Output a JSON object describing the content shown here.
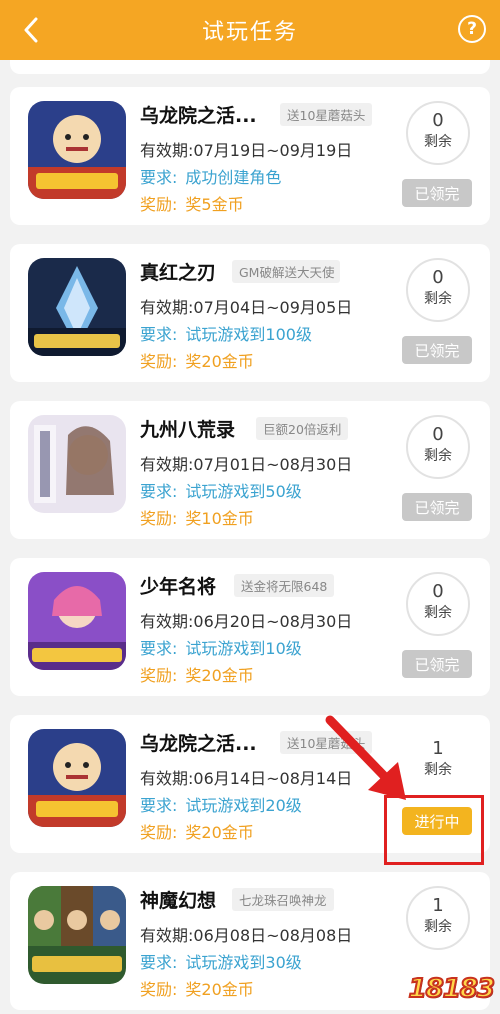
{
  "header": {
    "title": "试玩任务",
    "help_symbol": "?"
  },
  "labels": {
    "valid_prefix": "有效期:",
    "requirement": "要求:",
    "reward": "奖励:",
    "remain": "剩余"
  },
  "tasks": [
    {
      "name": "乌龙院之活...",
      "tag": "送10星蘑菇头",
      "valid": "07月19日~09月19日",
      "requirement": "成功创建角色",
      "reward": "奖5金币",
      "remaining": "0",
      "status": "已领完",
      "status_type": "done",
      "icon": "wulongyuan-game-icon"
    },
    {
      "name": "真红之刃",
      "tag": "GM破解送大天使",
      "valid": "07月04日~09月05日",
      "requirement": "试玩游戏到100级",
      "reward": "奖20金币",
      "remaining": "0",
      "status": "已领完",
      "status_type": "done",
      "icon": "zhenhong-game-icon"
    },
    {
      "name": "九州八荒录",
      "tag": "巨额20倍返利",
      "valid": "07月01日~08月30日",
      "requirement": "试玩游戏到50级",
      "reward": "奖10金币",
      "remaining": "0",
      "status": "已领完",
      "status_type": "done",
      "icon": "jiuzhou-game-icon"
    },
    {
      "name": "少年名将",
      "tag": "送金将无限648",
      "valid": "06月20日~08月30日",
      "requirement": "试玩游戏到10级",
      "reward": "奖20金币",
      "remaining": "0",
      "status": "已领完",
      "status_type": "done",
      "icon": "shaonian-game-icon"
    },
    {
      "name": "乌龙院之活...",
      "tag": "送10星蘑菇头",
      "valid": "06月14日~08月14日",
      "requirement": "试玩游戏到20级",
      "reward": "奖20金币",
      "remaining": "1",
      "status": "进行中",
      "status_type": "active",
      "icon": "wulongyuan-game-icon"
    },
    {
      "name": "神魔幻想",
      "tag": "七龙珠召唤神龙",
      "valid": "06月08日~08月08日",
      "requirement": "试玩游戏到30级",
      "reward": "奖20金币",
      "remaining": "1",
      "status": "",
      "status_type": "none",
      "icon": "shenmo-game-icon"
    }
  ],
  "watermark": "18183",
  "colors": {
    "header": "#f5a623",
    "requirement": "#3ba3d0",
    "reward": "#f0a020",
    "active_button": "#f3b41f",
    "done_button": "#c8c8c8",
    "highlight": "#e02020"
  }
}
